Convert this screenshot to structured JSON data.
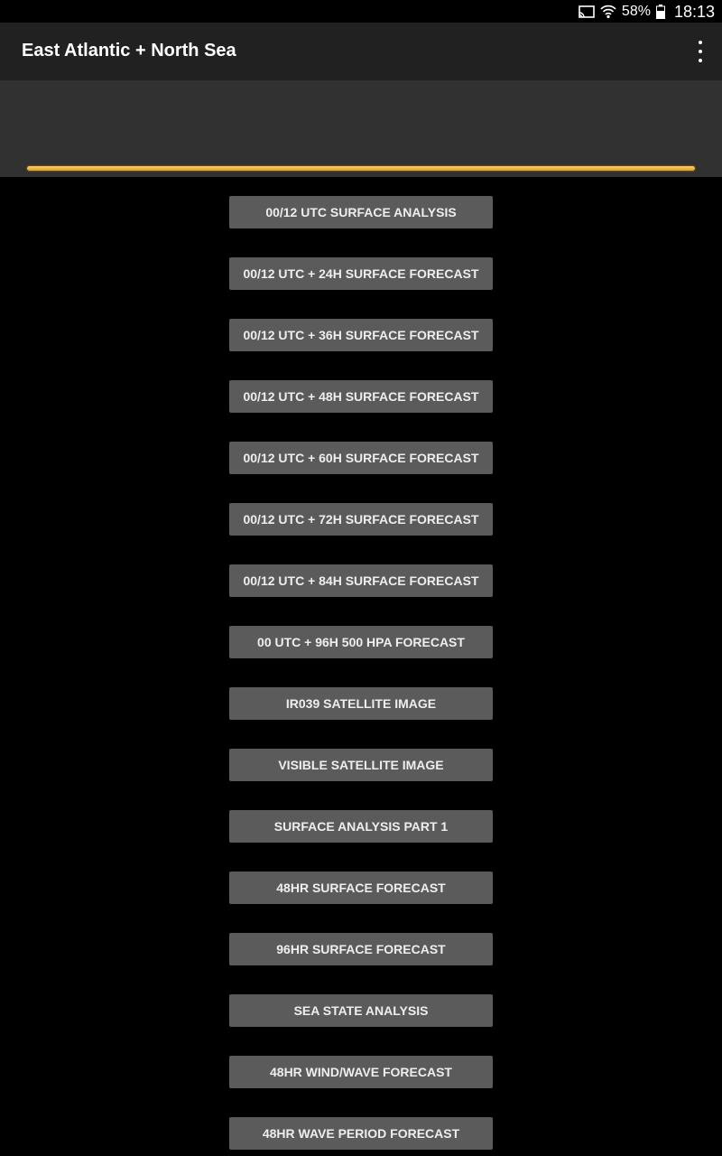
{
  "status_bar": {
    "cast_icon": "cast-icon",
    "wifi_icon": "wifi-icon",
    "battery_percent": "58%",
    "battery_icon": "battery-icon",
    "time": "18:13"
  },
  "app_bar": {
    "title": "East Atlantic + North Sea",
    "menu_icon": "more-vert-icon"
  },
  "progress": {
    "value": 1.0,
    "color": "#f2b636"
  },
  "buttons": [
    "00/12 UTC SURFACE ANALYSIS",
    "00/12 UTC + 24H SURFACE FORECAST",
    "00/12 UTC + 36H SURFACE FORECAST",
    "00/12 UTC + 48H SURFACE FORECAST",
    "00/12 UTC + 60H SURFACE FORECAST",
    "00/12 UTC + 72H SURFACE FORECAST",
    "00/12 UTC + 84H SURFACE FORECAST",
    "00 UTC + 96H 500 HPA FORECAST",
    "IR039 SATELLITE IMAGE",
    "VISIBLE SATELLITE IMAGE",
    "SURFACE ANALYSIS PART 1",
    "48HR SURFACE FORECAST",
    "96HR SURFACE FORECAST",
    "SEA STATE ANALYSIS",
    "48HR WIND/WAVE FORECAST",
    "48HR WAVE PERIOD FORECAST"
  ]
}
